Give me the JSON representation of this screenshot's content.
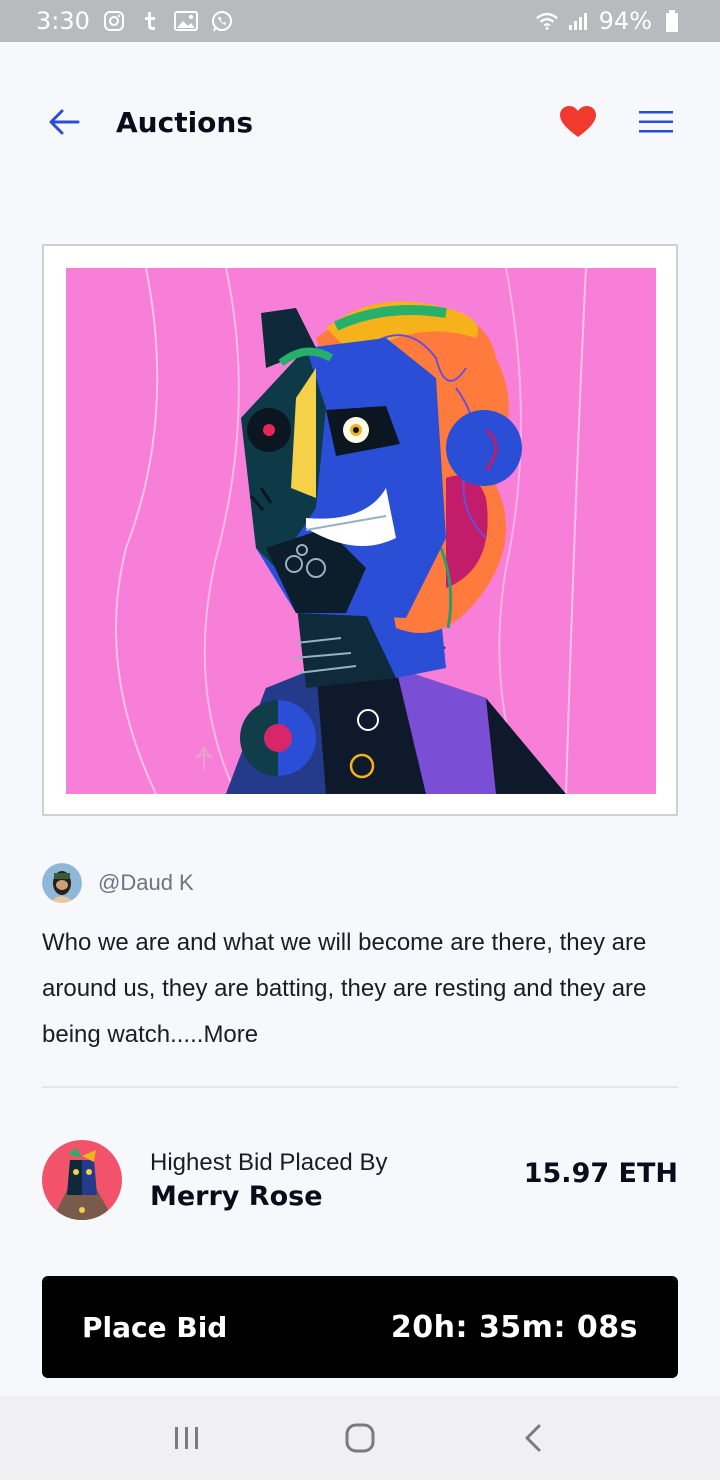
{
  "status_bar": {
    "time": "3:30",
    "battery": "94%",
    "left_icons": [
      "instagram-icon",
      "tumblr-icon",
      "image-icon",
      "whatsapp-icon"
    ],
    "right_icons": [
      "wifi-icon",
      "signal-icon",
      "battery-icon"
    ]
  },
  "header": {
    "title": "Auctions",
    "accent_color": "#2a4fd6",
    "heart_color": "#f03a2e"
  },
  "artwork": {
    "background_color": "#f77fd8"
  },
  "author": {
    "handle": "@Daud K"
  },
  "description": {
    "text": "Who we are and what we will become are there, they are around us, they are batting, they are resting and they are being watch.....",
    "more_label": "More"
  },
  "bid": {
    "caption": "Highest Bid Placed By",
    "bidder_name": "Merry Rose",
    "amount": "15.97 ETH"
  },
  "action": {
    "place_bid_label": "Place Bid",
    "countdown": "20h: 35m: 08s"
  },
  "nav_bar": {
    "icons": [
      "recent-apps-icon",
      "home-icon",
      "back-nav-icon"
    ]
  }
}
